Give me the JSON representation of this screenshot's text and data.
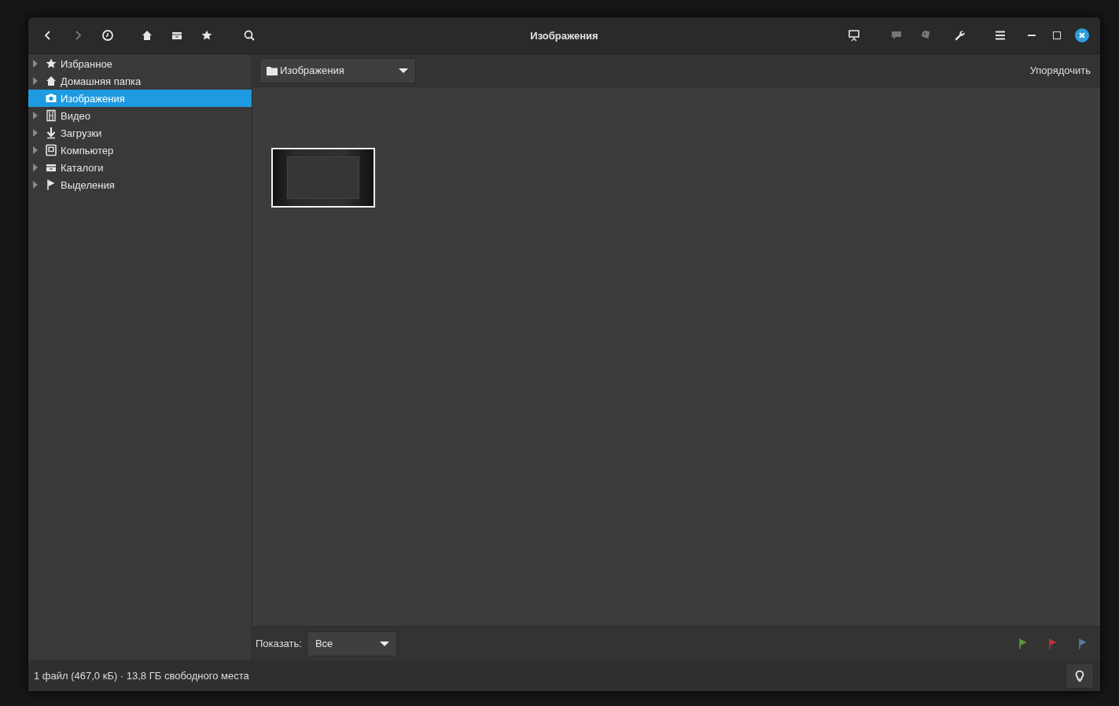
{
  "window": {
    "title": "Изображения"
  },
  "nav_buttons": [
    {
      "disabled": false
    },
    {
      "disabled": true
    },
    {
      "disabled": false
    },
    {
      "disabled": false
    },
    {
      "disabled": false
    },
    {
      "disabled": false
    },
    {
      "disabled": false
    }
  ],
  "tool_buttons": [
    {
      "disabled": false
    },
    {
      "disabled": true
    },
    {
      "disabled": true
    },
    {
      "disabled": false
    },
    {
      "disabled": false
    }
  ],
  "sidebar": {
    "items": [
      {
        "label": "Избранное",
        "expandable": true,
        "selected": false
      },
      {
        "label": "Домашняя папка",
        "expandable": true,
        "selected": false
      },
      {
        "label": "Изображения",
        "expandable": false,
        "selected": true
      },
      {
        "label": "Видео",
        "expandable": true,
        "selected": false
      },
      {
        "label": "Загрузки",
        "expandable": true,
        "selected": false
      },
      {
        "label": "Компьютер",
        "expandable": true,
        "selected": false
      },
      {
        "label": "Каталоги",
        "expandable": true,
        "selected": false
      },
      {
        "label": "Выделения",
        "expandable": true,
        "selected": false
      }
    ]
  },
  "path_bar": {
    "folder": "Изображения",
    "sort_label": "Упорядочить"
  },
  "filter_bar": {
    "label": "Показать:",
    "value": "Все",
    "flags": [
      {
        "color": "#5c9a3a"
      },
      {
        "color": "#b8343c"
      },
      {
        "color": "#5a7ba8"
      }
    ]
  },
  "status_bar": {
    "text": "1 файл (467,0 кБ) · 13,8 ГБ свободного места"
  }
}
